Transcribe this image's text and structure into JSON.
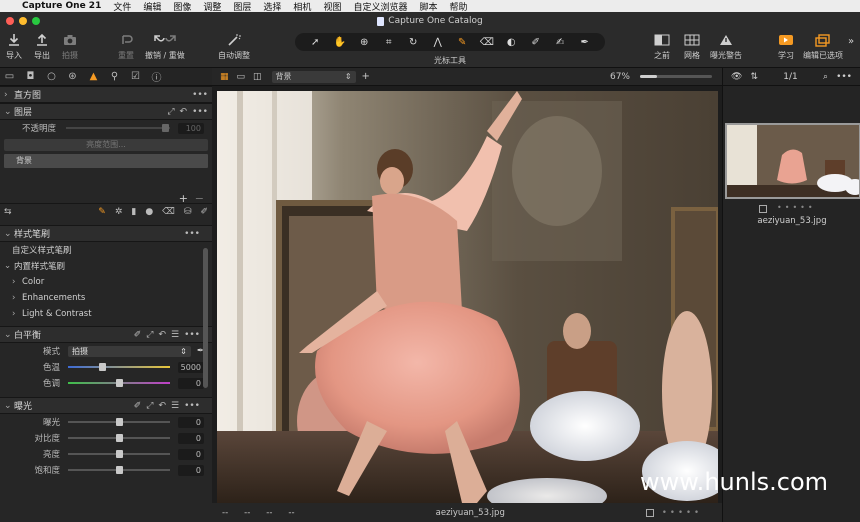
{
  "menubar": {
    "app": "Capture One 21",
    "items": [
      "文件",
      "编辑",
      "图像",
      "调整",
      "图层",
      "选择",
      "相机",
      "视图",
      "自定义浏览器",
      "脚本",
      "帮助"
    ]
  },
  "window": {
    "title": "Capture One Catalog"
  },
  "toolbar": {
    "import": "导入",
    "export": "导出",
    "capture": "拍摄",
    "reset": "重置",
    "undo_redo": "撤销 / 重做",
    "auto_adjust": "自动调整",
    "cursor_tools": "光标工具",
    "before": "之前",
    "grid": "网格",
    "exposure_warning": "曝光警告",
    "learn": "学习",
    "edit_selected": "编辑已选项"
  },
  "left_panel": {
    "histogram": {
      "title": "直方图"
    },
    "layers": {
      "title": "图层",
      "opacity_label": "不透明度",
      "opacity_value": "100",
      "luma_range_button": "亮度范围...",
      "layer_name": "背景"
    },
    "style_brushes": {
      "title": "样式笔刷",
      "custom": "自定义样式笔刷",
      "builtin": "内置样式笔刷",
      "groups": [
        "Color",
        "Enhancements",
        "Light & Contrast"
      ]
    },
    "white_balance": {
      "title": "白平衡",
      "mode_label": "模式",
      "mode_value": "拍摄",
      "temp_label": "色温",
      "temp_value": "5000",
      "tint_label": "色调",
      "tint_value": "0"
    },
    "exposure": {
      "title": "曝光",
      "rows": [
        {
          "label": "曝光",
          "value": "0"
        },
        {
          "label": "对比度",
          "value": "0"
        },
        {
          "label": "亮度",
          "value": "0"
        },
        {
          "label": "饱和度",
          "value": "0"
        }
      ]
    }
  },
  "viewer": {
    "layer_select": "背景",
    "zoom": "67%",
    "filename": "aeziyuan_53.jpg",
    "meta_placeholders": [
      "--",
      "--",
      "--",
      "--"
    ]
  },
  "browser": {
    "count": "1/1",
    "thumb_filename": "aeziyuan_53.jpg"
  },
  "watermark": "www.hunls.com"
}
